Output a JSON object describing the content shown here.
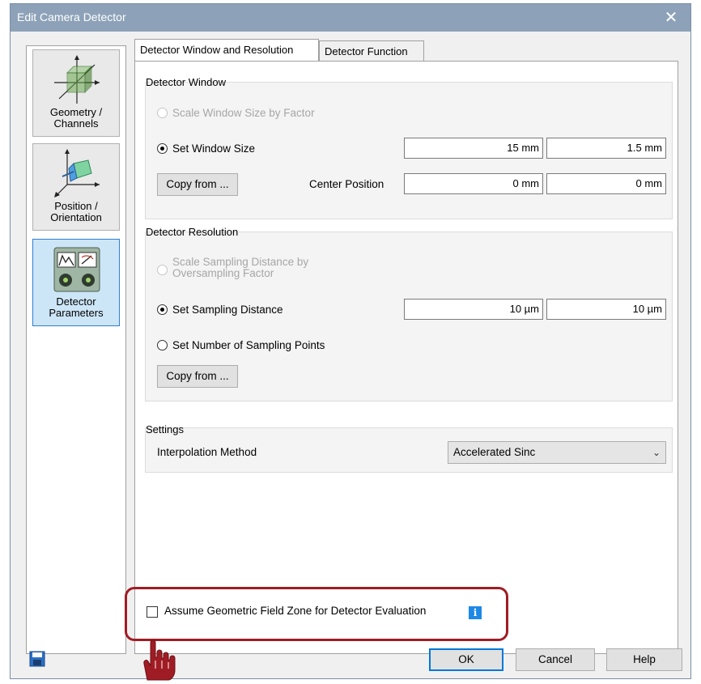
{
  "window": {
    "title": "Edit Camera Detector",
    "close_glyph": "✕"
  },
  "sidebar": {
    "items": [
      {
        "label_line1": "Geometry /",
        "label_line2": "Channels",
        "icon": "geometry-cube-icon"
      },
      {
        "label_line1": "Position /",
        "label_line2": "Orientation",
        "icon": "position-axes-icon"
      },
      {
        "label_line1": "Detector",
        "label_line2": "Parameters",
        "icon": "detector-instrument-icon"
      }
    ]
  },
  "tabs": [
    {
      "label": "Detector Window and Resolution"
    },
    {
      "label": "Detector Function"
    }
  ],
  "detector_window": {
    "group_label": "Detector Window",
    "scale_option": "Scale Window Size by Factor",
    "set_option": "Set Window Size",
    "width": "15 mm",
    "height": "1.5 mm",
    "copy_button": "Copy from ...",
    "center_label": "Center Position",
    "center_x": "0 mm",
    "center_y": "0 mm",
    "times": "×"
  },
  "detector_resolution": {
    "group_label": "Detector Resolution",
    "scale_option_line1": "Scale Sampling Distance by",
    "scale_option_line2": "Oversampling Factor",
    "set_distance_option": "Set Sampling Distance",
    "distance_x": "10 µm",
    "distance_y": "10 µm",
    "set_points_option": "Set Number of Sampling Points",
    "copy_button": "Copy from ...",
    "times": "×"
  },
  "settings": {
    "group_label": "Settings",
    "interp_label": "Interpolation Method",
    "interp_value": "Accelerated Sinc"
  },
  "footer": {
    "geometric_checkbox_label": "Assume Geometric Field Zone for Detector Evaluation",
    "info_glyph": "i",
    "ok": "OK",
    "cancel": "Cancel",
    "help": "Help"
  },
  "colors": {
    "highlight": "#a01c24",
    "titlebar": "#8da2b8",
    "accent": "#0078d7"
  }
}
